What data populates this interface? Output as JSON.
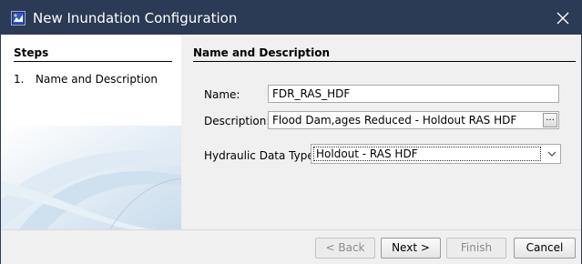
{
  "window": {
    "title": "New Inundation Configuration",
    "titlebar_color": "#2b3a55",
    "app_icon": "map-icon",
    "close_icon": "close-icon"
  },
  "steps": {
    "header": "Steps",
    "items": [
      {
        "number": "1.",
        "label": "Name and Description"
      }
    ]
  },
  "main": {
    "section_title": "Name and Description",
    "name_label": "Name:",
    "name_value": "FDR_RAS_HDF",
    "description_label": "Description:",
    "description_value": "Flood Dam,ages Reduced - Holdout RAS HDF",
    "description_button": "...",
    "hydraulic_label": "Hydraulic Data Type:",
    "hydraulic_value": "Holdout - RAS HDF"
  },
  "footer": {
    "back": "< Back",
    "next": "Next >",
    "finish": "Finish",
    "cancel": "Cancel"
  }
}
